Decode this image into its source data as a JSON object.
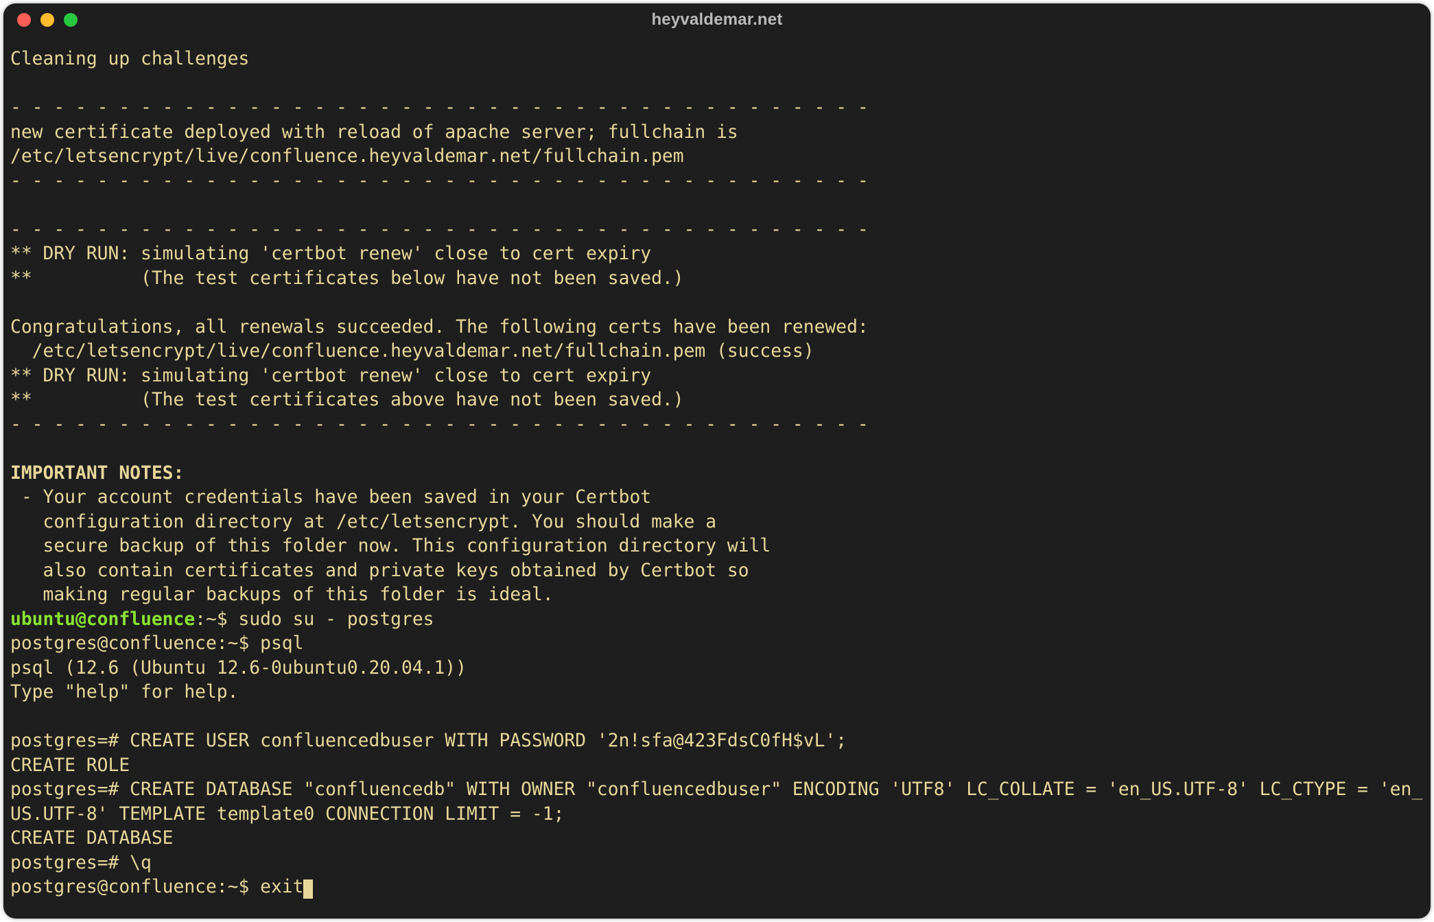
{
  "window": {
    "title": "heyvaldemar.net"
  },
  "colors": {
    "bg": "#1e1e1e",
    "text": "#e7d89a",
    "promptUser": "#8ae234",
    "trafficRed": "#ff5f57",
    "trafficYellow": "#febc2e",
    "trafficGreen": "#28c840"
  },
  "lines": {
    "l1": "Cleaning up challenges",
    "l2": "",
    "l3": "- - - - - - - - - - - - - - - - - - - - - - - - - - - - - - - - - - - - - - - -",
    "l4": "new certificate deployed with reload of apache server; fullchain is",
    "l5": "/etc/letsencrypt/live/confluence.heyvaldemar.net/fullchain.pem",
    "l6": "- - - - - - - - - - - - - - - - - - - - - - - - - - - - - - - - - - - - - - - -",
    "l7": "",
    "l8": "- - - - - - - - - - - - - - - - - - - - - - - - - - - - - - - - - - - - - - - -",
    "l9": "** DRY RUN: simulating 'certbot renew' close to cert expiry",
    "l10": "**          (The test certificates below have not been saved.)",
    "l11": "",
    "l12": "Congratulations, all renewals succeeded. The following certs have been renewed:",
    "l13": "  /etc/letsencrypt/live/confluence.heyvaldemar.net/fullchain.pem (success)",
    "l14": "** DRY RUN: simulating 'certbot renew' close to cert expiry",
    "l15": "**          (The test certificates above have not been saved.)",
    "l16": "- - - - - - - - - - - - - - - - - - - - - - - - - - - - - - - - - - - - - - - -",
    "l17": "",
    "l18_bold": "IMPORTANT NOTES:",
    "l19": " - Your account credentials have been saved in your Certbot",
    "l20": "   configuration directory at /etc/letsencrypt. You should make a",
    "l21": "   secure backup of this folder now. This configuration directory will",
    "l22": "   also contain certificates and private keys obtained by Certbot so",
    "l23": "   making regular backups of this folder is ideal.",
    "p1_user": "ubuntu@confluence",
    "p1_rest": ":~$ ",
    "p1_cmd": "sudo su - postgres",
    "l25": "postgres@confluence:~$ psql",
    "l26": "psql (12.6 (Ubuntu 12.6-0ubuntu0.20.04.1))",
    "l27": "Type \"help\" for help.",
    "l28": "",
    "l29": "postgres=# CREATE USER confluencedbuser WITH PASSWORD '2n!sfa@423FdsC0fH$vL';",
    "l30": "CREATE ROLE",
    "l31": "postgres=# CREATE DATABASE \"confluencedb\" WITH OWNER \"confluencedbuser\" ENCODING 'UTF8' LC_COLLATE = 'en_US.UTF-8' LC_CTYPE = 'en_US.UTF-8' TEMPLATE template0 CONNECTION LIMIT = -1;",
    "l32": "CREATE DATABASE",
    "l33": "postgres=# \\q",
    "l34_prompt": "postgres@confluence:~$ ",
    "l34_cmd": "exit"
  }
}
